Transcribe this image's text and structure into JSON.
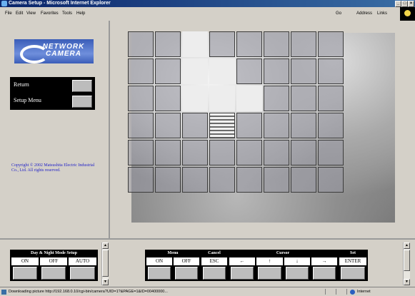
{
  "window": {
    "title": "Camera Setup - Microsoft Internet Explorer"
  },
  "menubar": {
    "items": [
      "File",
      "Edit",
      "View",
      "Favorites",
      "Tools",
      "Help"
    ],
    "go_label": "Go",
    "address_label": "Address",
    "links_label": "Links"
  },
  "left": {
    "logo_text": "NETWORK CAMERA",
    "nav": [
      {
        "label": "Return"
      },
      {
        "label": "Setup Menu"
      }
    ],
    "copyright": "Copyright © 2002 Matsushita Electric Industrial Co., Ltd. All rights reserved."
  },
  "grid": {
    "cols": 8,
    "rows": 6,
    "masked_cells": [
      [
        2,
        0
      ],
      [
        2,
        1
      ],
      [
        3,
        1
      ],
      [
        2,
        2
      ],
      [
        3,
        2
      ],
      [
        4,
        2
      ]
    ],
    "striped_cells": [
      [
        3,
        3
      ]
    ]
  },
  "daynight": {
    "title": "Day & Night Mode Setup",
    "options": [
      "ON",
      "OFF",
      "AUTO"
    ]
  },
  "controls": {
    "menu_header": "Menu",
    "cancel_header": "Cancel",
    "cursor_header": "Cursor",
    "set_header": "Set",
    "menu_on": "ON",
    "menu_off": "OFF",
    "cancel": "ESC",
    "left": "←",
    "up": "↑",
    "down": "↓",
    "right": "→",
    "set": "ENTER"
  },
  "status": {
    "message": "Downloading picture http://192.168.0.10/cgi-bin/camera?UID=1?&PAGE=1&ID=00400000...",
    "zone": "Internet"
  }
}
